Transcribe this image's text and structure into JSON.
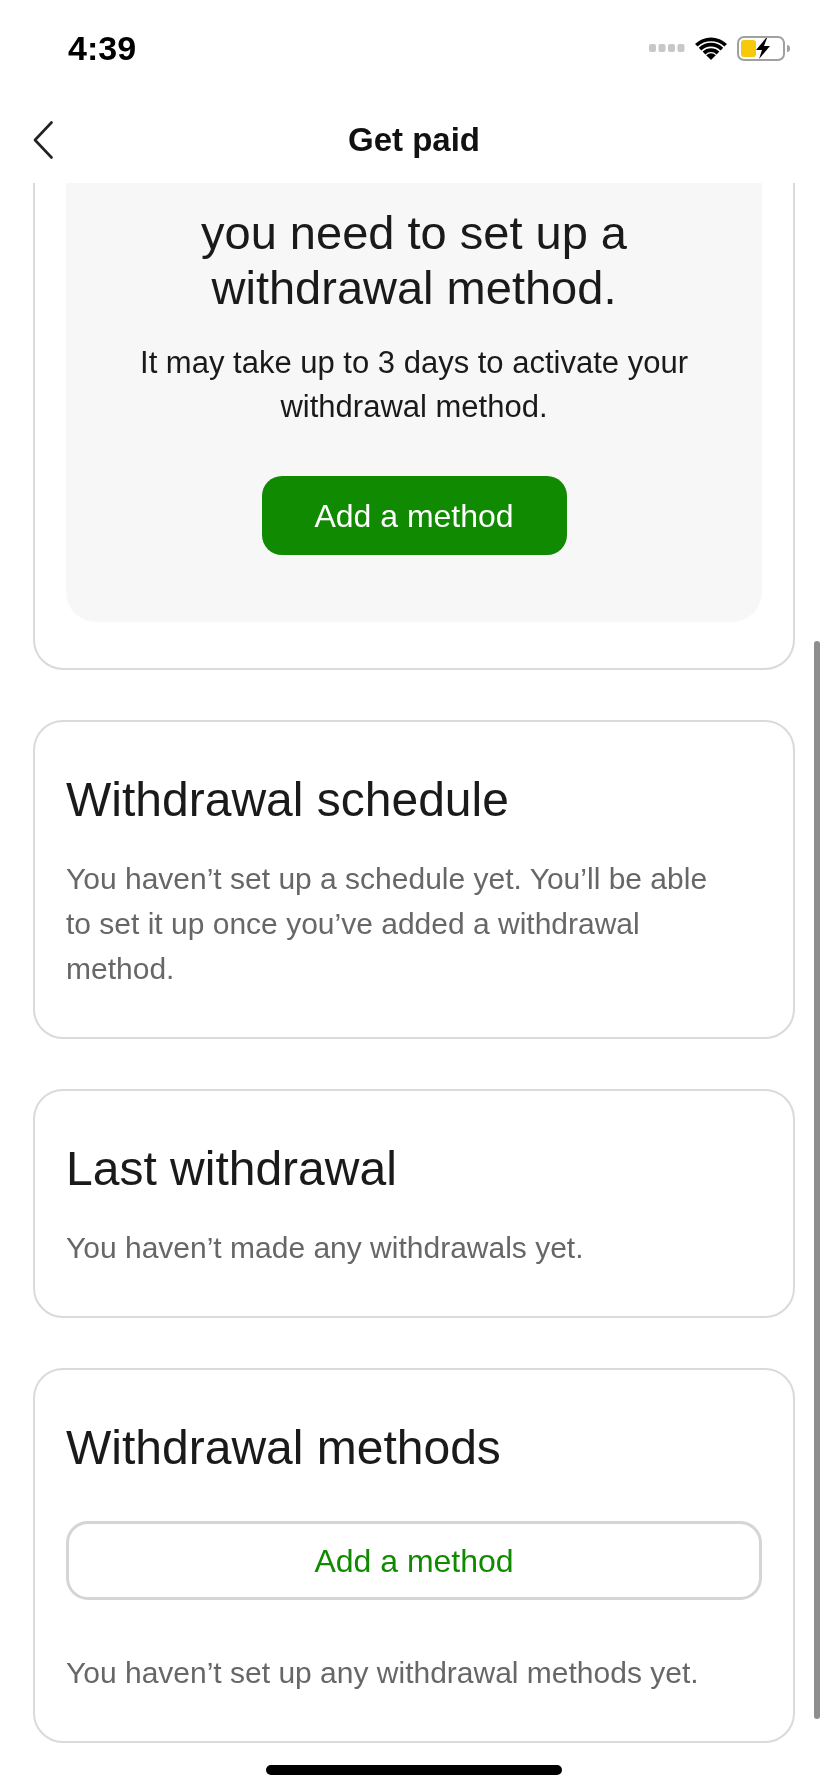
{
  "status_bar": {
    "time": "4:39"
  },
  "nav": {
    "title": "Get paid"
  },
  "setup_card": {
    "heading": "you need to set up a withdrawal method.",
    "text": "It may take up to 3 days to activate your withdrawal method.",
    "button": "Add a method"
  },
  "sections": [
    {
      "kind": "text",
      "title": "Withdrawal schedule",
      "text": "You haven’t set up a schedule yet. You’ll be able to set it up once you’ve added a withdrawal method."
    },
    {
      "kind": "text",
      "title": "Last withdrawal",
      "text": "You haven’t made any withdrawals yet."
    },
    {
      "kind": "action",
      "title": "Withdrawal methods",
      "button": "Add a method",
      "text": "You haven’t set up any withdrawal methods yet."
    }
  ]
}
